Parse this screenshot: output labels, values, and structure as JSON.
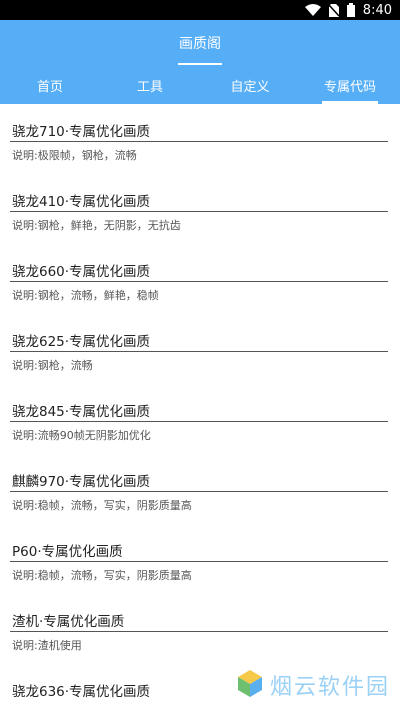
{
  "status_bar": {
    "time": "8:40",
    "icons": [
      "wifi-icon",
      "no-sim-icon",
      "battery-icon"
    ]
  },
  "header": {
    "title": "画质阁"
  },
  "tabs": [
    {
      "label": "首页",
      "active": false
    },
    {
      "label": "工具",
      "active": false
    },
    {
      "label": "自定义",
      "active": false
    },
    {
      "label": "专属代码",
      "active": true
    }
  ],
  "items": [
    {
      "title": "骁龙710·专属优化画质",
      "desc": "说明:极限帧，钢枪，流畅"
    },
    {
      "title": "骁龙410·专属优化画质",
      "desc": "说明:钢枪，鲜艳，无阴影，无抗齿"
    },
    {
      "title": "骁龙660·专属优化画质",
      "desc": "说明:钢枪，流畅，鲜艳，稳帧"
    },
    {
      "title": "骁龙625·专属优化画质",
      "desc": "说明:钢枪，流畅"
    },
    {
      "title": "骁龙845·专属优化画质",
      "desc": "说明:流畅90帧无阴影加优化"
    },
    {
      "title": "麒麟970·专属优化画质",
      "desc": "说明:稳帧，流畅，写实，阴影质量高"
    },
    {
      "title": "P60·专属优化画质",
      "desc": "说明:稳帧，流畅，写实，阴影质量高"
    },
    {
      "title": "渣机·专属优化画质",
      "desc": "说明:渣机使用"
    },
    {
      "title": "骁龙636·专属优化画质",
      "desc": ""
    }
  ],
  "watermark": {
    "text": "烟云软件园"
  },
  "colors": {
    "accent": "#56aef6",
    "text": "#222222",
    "muted": "#555555"
  }
}
